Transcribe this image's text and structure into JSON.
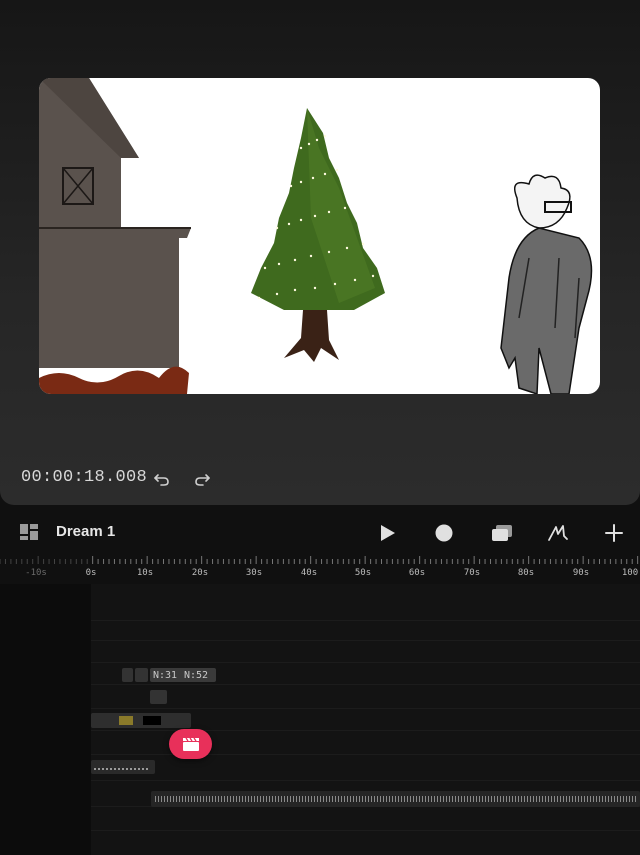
{
  "preview": {
    "timecode": "00:00:18.008",
    "undo_icon": "undo-icon",
    "redo_icon": "redo-icon"
  },
  "toolbar": {
    "project_title": "Dream 1",
    "layout_icon": "layout-grid-icon",
    "play_icon": "play-icon",
    "record_icon": "record-icon",
    "layers_icon": "layers-icon",
    "draw_icon": "draw-icon",
    "add_icon": "plus-icon"
  },
  "ruler": {
    "labels": [
      "-10s",
      "0s",
      "10s",
      "20s",
      "30s",
      "40s",
      "50s",
      "60s",
      "70s",
      "80s",
      "90s",
      "100"
    ]
  },
  "timeline": {
    "clip_label_1": "N:31",
    "clip_label_2": "N:52",
    "fab_icon": "clapperboard-icon"
  },
  "colors": {
    "accent": "#e8305a",
    "background": "#101010",
    "panel": "#262626"
  }
}
